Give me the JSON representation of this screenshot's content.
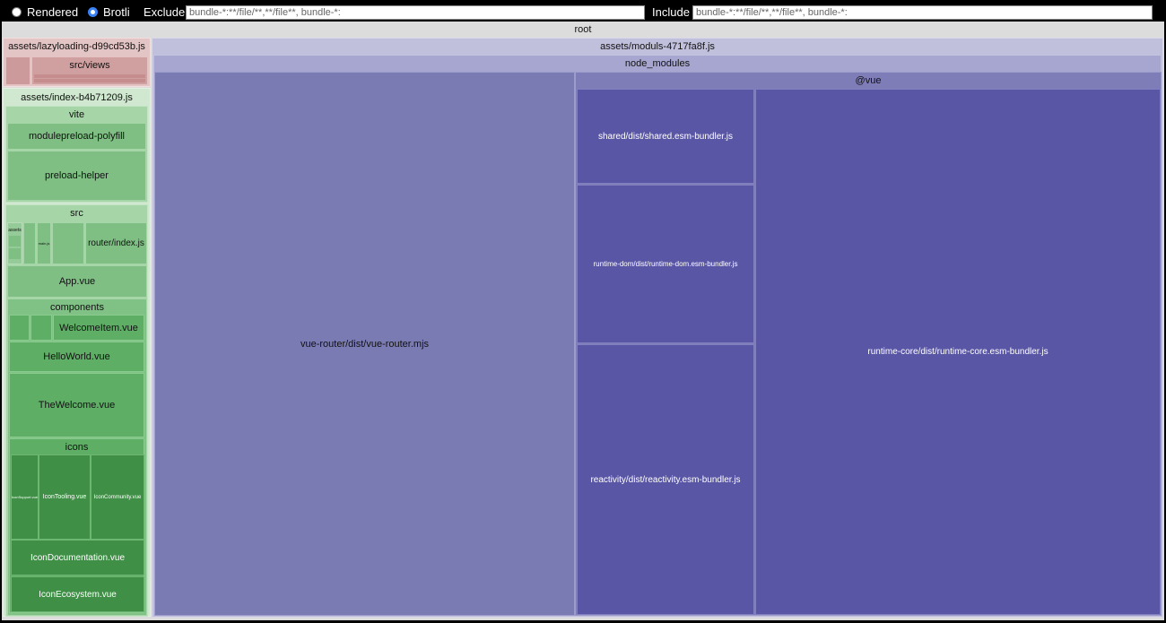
{
  "toolbar": {
    "rendered_label": "Rendered",
    "brotli_label": "Brotli",
    "selected_mode": "Brotli",
    "exclude_label": "Exclude",
    "exclude_value": "bundle-*:**/file/**,**/file**, bundle-*:",
    "include_label": "Include",
    "include_value": "bundle-*:**/file/**,**/file**, bundle-*:"
  },
  "colors": {
    "accent": "#3b82f6",
    "lazy_bundle": "#d4a4a4",
    "index_bundle": "#7fbf84",
    "moduls_bundle": "#7b7bb4",
    "vue_modules": "#5a56a6"
  },
  "treemap": {
    "root": "root",
    "lazy": {
      "title": "assets/lazyloading-d99cd53b.js",
      "src_views": "src/views"
    },
    "index": {
      "title": "assets/index-b4b71209.js",
      "vite": "vite",
      "modulepreload_polyfill": "modulepreload-polyfill",
      "preload_helper": "preload-helper",
      "src": "src",
      "assets": "assets",
      "main_js": "main.js",
      "router_index": "router/index.js",
      "app_vue": "App.vue",
      "components": "components",
      "welcome_item": "WelcomeItem.vue",
      "hello_world": "HelloWorld.vue",
      "the_welcome": "TheWelcome.vue",
      "icons": "icons",
      "icon_support": "IconSupport.vue",
      "icon_tooling": "IconTooling.vue",
      "icon_community": "IconCommunity.vue",
      "icon_documentation": "IconDocumentation.vue",
      "icon_ecosystem": "IconEcosystem.vue"
    },
    "moduls": {
      "title": "assets/moduls-4717fa8f.js",
      "node_modules": "node_modules",
      "vue_router": "vue-router/dist/vue-router.mjs",
      "vue_scope": "@vue",
      "shared": "shared/dist/shared.esm-bundler.js",
      "runtime_dom": "runtime-dom/dist/runtime-dom.esm-bundler.js",
      "reactivity": "reactivity/dist/reactivity.esm-bundler.js",
      "runtime_core": "runtime-core/dist/runtime-core.esm-bundler.js"
    }
  }
}
